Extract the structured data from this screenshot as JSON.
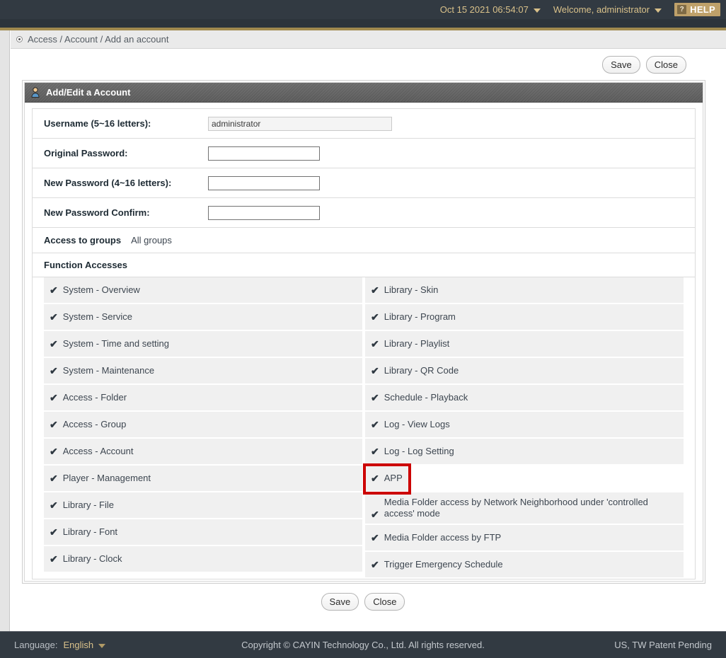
{
  "topbar": {
    "datetime": "Oct 15 2021 06:54:07",
    "welcome": "Welcome, administrator",
    "help_label": "HELP",
    "help_mark": "?"
  },
  "breadcrumb": {
    "text": "Access / Account / Add an account"
  },
  "actions": {
    "save_label": "Save",
    "close_label": "Close"
  },
  "panel": {
    "title": "Add/Edit a Account",
    "fields": [
      {
        "label": "Username (5~16 letters):",
        "value": "administrator",
        "type": "text",
        "disabled": true
      },
      {
        "label": "Original Password:",
        "value": "",
        "type": "password",
        "disabled": false
      },
      {
        "label": "New Password (4~16 letters):",
        "value": "",
        "type": "password",
        "disabled": false
      },
      {
        "label": "New Password Confirm:",
        "value": "",
        "type": "password",
        "disabled": false
      }
    ],
    "groups": {
      "label": "Access to groups",
      "value": "All groups"
    },
    "function_accesses": {
      "title": "Function Accesses",
      "check_glyph": "✔",
      "left_column": [
        {
          "label": "System - Overview",
          "checked": true
        },
        {
          "label": "System - Service",
          "checked": true
        },
        {
          "label": "System - Time and setting",
          "checked": true
        },
        {
          "label": "System - Maintenance",
          "checked": true
        },
        {
          "label": "Access - Folder",
          "checked": true
        },
        {
          "label": "Access - Group",
          "checked": true
        },
        {
          "label": "Access - Account",
          "checked": true
        },
        {
          "label": "Player - Management",
          "checked": true
        },
        {
          "label": "Library - File",
          "checked": true
        },
        {
          "label": "Library - Font",
          "checked": true
        },
        {
          "label": "Library - Clock",
          "checked": true
        }
      ],
      "right_column": [
        {
          "label": "Library - Skin",
          "checked": true
        },
        {
          "label": "Library - Program",
          "checked": true
        },
        {
          "label": "Library - Playlist",
          "checked": true
        },
        {
          "label": "Library - QR Code",
          "checked": true
        },
        {
          "label": "Schedule - Playback",
          "checked": true
        },
        {
          "label": "Log - View Logs",
          "checked": true
        },
        {
          "label": "Log - Log Setting",
          "checked": true
        },
        {
          "label": "APP",
          "checked": true,
          "highlight": true
        },
        {
          "label": "Media Folder access by Network Neighborhood under 'controlled access' mode",
          "checked": true,
          "two_line": true
        },
        {
          "label": "Media Folder access by FTP",
          "checked": true
        },
        {
          "label": "Trigger Emergency Schedule",
          "checked": true
        }
      ]
    }
  },
  "footer": {
    "language_label": "Language:",
    "language_value": "English",
    "copyright": "Copyright © CAYIN Technology Co., Ltd. All rights reserved.",
    "patent": "US, TW Patent Pending"
  },
  "colors": {
    "topbar_bg": "#323a42",
    "accent_gold": "#d9c18a",
    "gold_rule": "#a08a4e",
    "highlight_red": "#cc0000",
    "row_bg": "#f0f0f0"
  }
}
